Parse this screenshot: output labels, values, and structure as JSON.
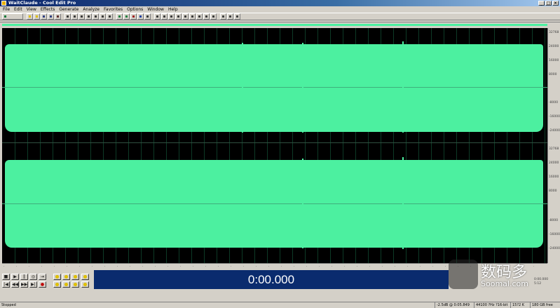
{
  "window": {
    "title": "WaitClaude - Cool Edit Pro"
  },
  "menu": [
    "File",
    "Edit",
    "View",
    "Effects",
    "Generate",
    "Analyze",
    "Favorites",
    "Options",
    "Window",
    "Help"
  ],
  "vertical_ruler": {
    "top": [
      "32768",
      "24000",
      "16000",
      "8000",
      "-8000",
      "-16000",
      "-24000"
    ],
    "bottom": [
      "32768",
      "24000",
      "16000",
      "8000",
      "-8000",
      "-16000",
      "-24000"
    ]
  },
  "time_display": "0:00.000",
  "selection": {
    "begin": "0:00.000",
    "end": "5:12"
  },
  "status": {
    "state": "Stopped",
    "level": "-2.5dB @ 0:05.849",
    "format": "44100 ?Hz ?16-bit ?Stereo",
    "size": "15?2 K",
    "free": "180 GB free"
  },
  "watermark": {
    "cn": "数码多",
    "en": "Soomal.com"
  },
  "colors": {
    "waveform": "#4cf0a0",
    "display_bg": "#0a2b6e",
    "title_bar": "#0a246a"
  }
}
